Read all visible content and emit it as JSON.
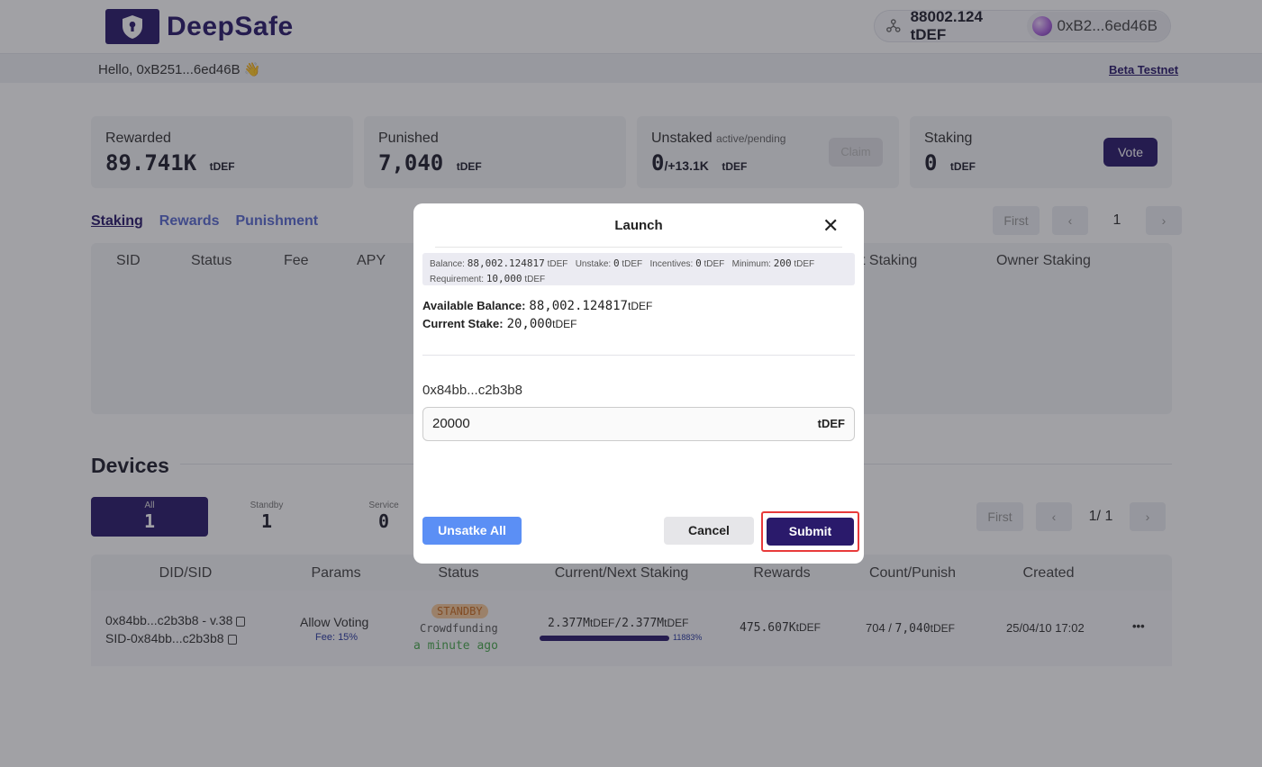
{
  "header": {
    "brand": "DeepSafe",
    "balance": "88002.124 tDEF",
    "wallet_address": "0xB2...6ed46B"
  },
  "subbar": {
    "greeting": "Hello, 0xB251...6ed46B 👋",
    "network_link": "Beta Testnet"
  },
  "stats": {
    "rewarded": {
      "label": "Rewarded",
      "value": "89.741K",
      "unit": "tDEF"
    },
    "punished": {
      "label": "Punished",
      "value": "7,040",
      "unit": "tDEF"
    },
    "unstaked": {
      "label": "Unstaked",
      "sublabel": "active/pending",
      "value": "0",
      "pending": "/+13.1K",
      "unit": "tDEF",
      "claim_label": "Claim"
    },
    "staking": {
      "label": "Staking",
      "value": "0",
      "unit": "tDEF",
      "vote_label": "Vote"
    }
  },
  "tabs": [
    "Staking",
    "Rewards",
    "Punishment"
  ],
  "pager_top": {
    "first": "First",
    "page": "1"
  },
  "staking_table": {
    "columns": [
      "SID",
      "Status",
      "Fee",
      "APY",
      "t Staking",
      "Owner Staking"
    ]
  },
  "devices": {
    "title": "Devices",
    "filters": [
      {
        "label": "All",
        "count": "1"
      },
      {
        "label": "Standby",
        "count": "1"
      },
      {
        "label": "Service",
        "count": "0"
      }
    ],
    "pager": {
      "first": "First",
      "page": "1/ 1"
    },
    "columns": [
      "DID/SID",
      "Params",
      "Status",
      "Current/Next Staking",
      "Rewards",
      "Count/Punish",
      "Created"
    ],
    "row": {
      "did": "0x84bb...c2b3b8 - v.38",
      "sid": "SID-0x84bb...c2b3b8",
      "params": "Allow Voting",
      "fee": "Fee: 15%",
      "status_badge": "STANDBY",
      "status_sub": "Crowdfunding",
      "status_time": "a minute ago",
      "staking_current": "2.377M",
      "staking_next": "2.377M",
      "staking_unit": "tDEF",
      "staking_pct": "11883%",
      "rewards": "475.607K",
      "rewards_unit": "tDEF",
      "count": "704 / ",
      "punish": "7,040",
      "punish_unit": "tDEF",
      "created": "25/04/10 17:02",
      "more": "•••"
    }
  },
  "modal": {
    "title": "Launch",
    "close": "✕",
    "info": {
      "balance_label": "Balance:",
      "balance": "88,002.124817",
      "balance_unit": "tDEF",
      "unstake_label": "Unstake:",
      "unstake": "0",
      "unstake_unit": "tDEF",
      "incentives_label": "Incentives:",
      "incentives": "0",
      "incentives_unit": "tDEF",
      "minimum_label": "Minimum:",
      "minimum": "200",
      "minimum_unit": "tDEF",
      "requirement_label": "Requirement:",
      "requirement": "10,000",
      "requirement_unit": "tDEF"
    },
    "available_label": "Available Balance:",
    "available_value": "88,002.124817",
    "available_unit": "tDEF",
    "stake_label": "Current Stake:",
    "stake_value": "20,000",
    "stake_unit": "tDEF",
    "address": "0x84bb...c2b3b8",
    "amount": "20000",
    "amount_unit": "tDEF",
    "unstake_all": "Unsatke All",
    "cancel": "Cancel",
    "submit": "Submit"
  },
  "colors": {
    "brand": "#2a1a6b",
    "link": "#5a6bd0",
    "unstake_button": "#5b8ff5",
    "highlight": "#e83a3a"
  }
}
